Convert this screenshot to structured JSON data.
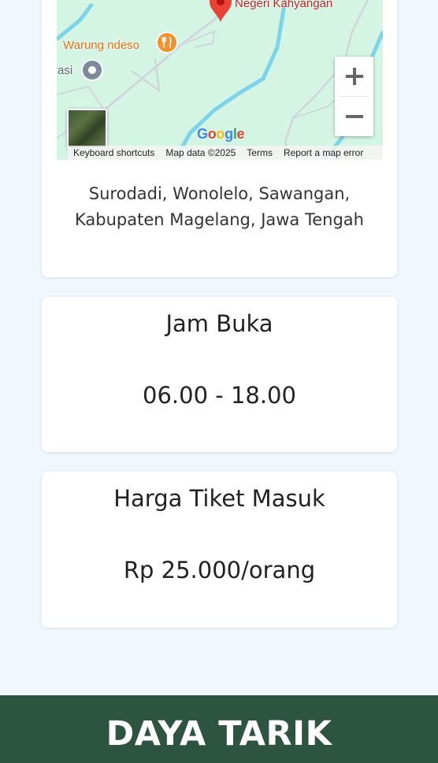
{
  "location": {
    "map": {
      "destination_label": "Negeri Kahyangan",
      "restaurant_label": "Warung ndeso",
      "poi_label": "rasi",
      "google_logo": "Google",
      "attribution": {
        "keyboard_shortcuts": "Keyboard shortcuts",
        "map_data": "Map data ©2025",
        "terms": "Terms",
        "report": "Report a map error"
      },
      "icons": {
        "zoom_in": "plus-icon",
        "zoom_out": "minus-icon",
        "destination_pin": "map-pin-icon",
        "restaurant_pin": "restaurant-icon",
        "poi_pin": "poi-marker-icon"
      },
      "colors": {
        "land": "#d4f5e4",
        "river": "#7dd3e8",
        "road": "#ffffff"
      }
    },
    "address": "Surodadi, Wonolelo, Sawangan, Kabupaten Magelang, Jawa Tengah"
  },
  "hours": {
    "title": "Jam Buka",
    "value": "06.00 - 18.00"
  },
  "ticket": {
    "title": "Harga Tiket Masuk",
    "value": "Rp 25.000/orang"
  },
  "footer": {
    "title": "DAYA TARIK"
  },
  "colors": {
    "page_background": "#f0f7fe",
    "footer_background": "#2d5441",
    "card_background": "#ffffff"
  }
}
